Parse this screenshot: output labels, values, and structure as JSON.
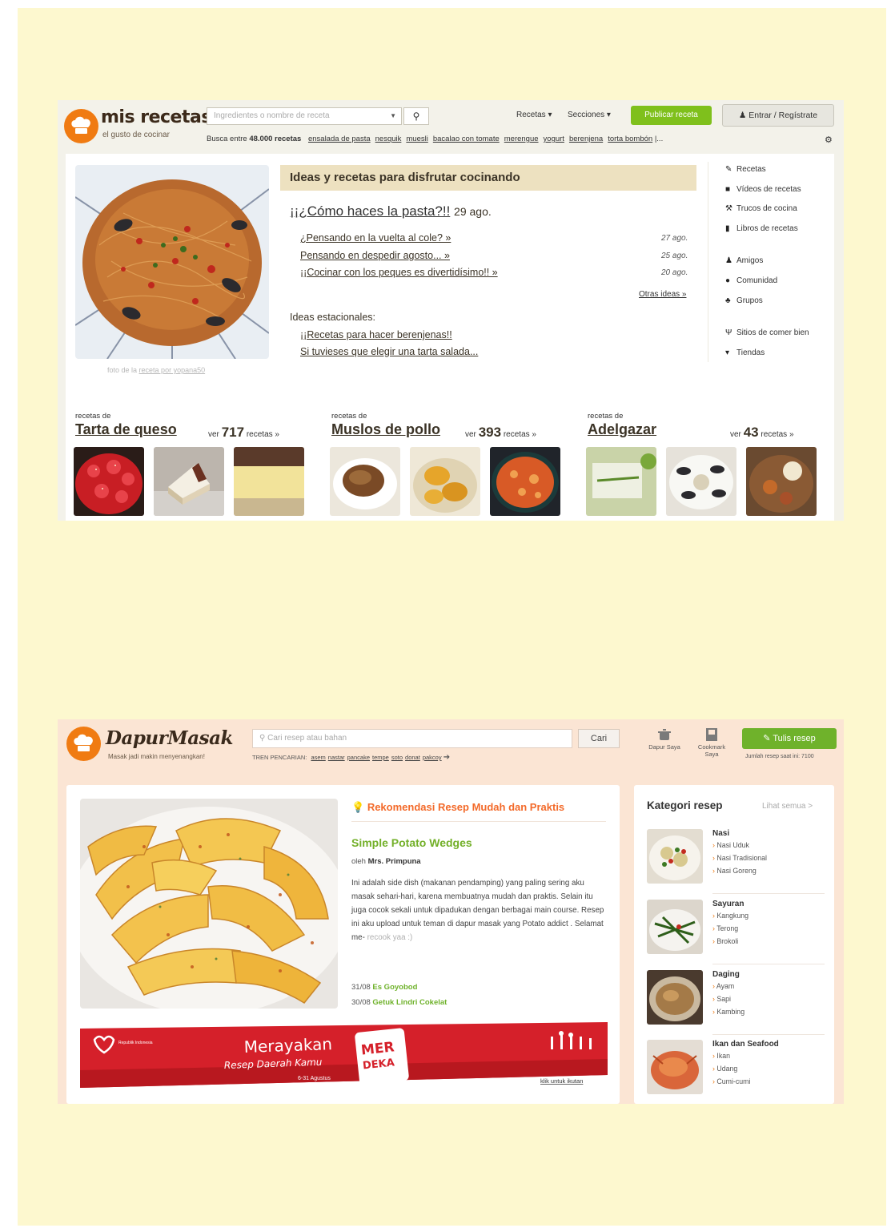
{
  "mis_recetas": {
    "brand": "mis recetas",
    "tagline": "el gusto de cocinar",
    "search_placeholder": "Ingredientes o nombre de receta",
    "busca_prefix": "Busca entre",
    "busca_count": "48.000 recetas",
    "busca_links": [
      "ensalada de pasta",
      "nesquik",
      "muesli",
      "bacalao con tomate",
      "merengue",
      "yogurt",
      "berenjena",
      "torta bombón"
    ],
    "more": "|...",
    "nav": [
      "Recetas ▾",
      "Secciones ▾"
    ],
    "publish": "Publicar receta",
    "login": "Entrar / Regístrate",
    "ideas_title": "Ideas y recetas para disfrutar cocinando",
    "main_idea": "¡¡¿Cómo haces la pasta?!!",
    "main_date": "29 ago.",
    "sub_ideas": [
      {
        "text": "¿Pensando en la vuelta al cole? »",
        "date": "27 ago."
      },
      {
        "text": "Pensando en despedir agosto... »",
        "date": "25 ago."
      },
      {
        "text": "¡¡Cocinar con los peques es divertidísimo!! »",
        "date": "20 ago."
      }
    ],
    "otras": "Otras ideas »",
    "estacionales_label": "Ideas estacionales:",
    "estacionales": [
      "¡¡Recetas para hacer berenjenas!!",
      "Si tuvieses que elegir una tarta salada..."
    ],
    "photo_credit_prefix": "foto de la",
    "photo_credit_link": "receta por yopana50",
    "side_links": [
      "Recetas",
      "Vídeos de recetas",
      "Trucos de cocina",
      "Libros de recetas",
      "Amigos",
      "Comunidad",
      "Grupos",
      "Sitios de comer bien",
      "Tiendas"
    ],
    "side_icons": [
      "pencil-icon",
      "video-icon",
      "tools-icon",
      "book-icon",
      "user-icon",
      "chat-icon",
      "group-icon",
      "cutlery-icon",
      "cart-icon"
    ],
    "categories": [
      {
        "pre": "recetas de",
        "name": "Tarta de queso",
        "ver": "ver",
        "count": "717",
        "suffix": "recetas »"
      },
      {
        "pre": "recetas de",
        "name": "Muslos de pollo",
        "ver": "ver",
        "count": "393",
        "suffix": "recetas »"
      },
      {
        "pre": "recetas de",
        "name": "Adelgazar",
        "ver": "ver",
        "count": "43",
        "suffix": "recetas »"
      }
    ]
  },
  "dapur": {
    "brand": "DapurMasak",
    "tagline": "Masak jadi makin menyenangkan!",
    "search_placeholder": "Cari resep atau bahan",
    "search_button": "Cari",
    "tren_label": "TREN PENCARIAN:",
    "tren_links": [
      "asem",
      "nastar",
      "pancake",
      "tempe",
      "soto",
      "donat",
      "pakcoy"
    ],
    "dapur_saya": "Dapur Saya",
    "cookmark_saya": "Cookmark Saya",
    "tulis_resep": "Tulis resep",
    "jumlah": "Jumlah resep saat ini: 7100",
    "rek_title": "Rekomendasi Resep Mudah dan Praktis",
    "recipe_title": "Simple Potato Wedges",
    "oleh": "oleh",
    "author": "Mrs. Primpuna",
    "desc_main": "Ini adalah side dish (makanan pendamping) yang paling sering aku masak sehari-hari, karena membuatnya mudah dan praktis. Selain itu juga cocok sekali untuk dipadukan dengan berbagai main course. Resep ini aku upload untuk teman di dapur masak yang Potato addict . Selamat me-",
    "desc_fade": "recook yaa :)",
    "related": [
      {
        "date": "31/08",
        "title": "Es Goyobod"
      },
      {
        "date": "30/08",
        "title": "Getuk Lindri Cokelat"
      }
    ],
    "banner_main": "Merayakan",
    "banner_sub": "Resep Daerah Kamu",
    "banner_date": "6-31 Agustus",
    "banner_badge_1": "MER",
    "banner_badge_2": "DEKA",
    "banner_link": "klik untuk ikutan",
    "banner_logo": "Republik Indonesia",
    "kategori_title": "Kategori resep",
    "lihat_semua": "Lihat semua >",
    "categories": [
      {
        "name": "Nasi",
        "items": [
          "Nasi Uduk",
          "Nasi Tradisional",
          "Nasi Goreng"
        ]
      },
      {
        "name": "Sayuran",
        "items": [
          "Kangkung",
          "Terong",
          "Brokoli"
        ]
      },
      {
        "name": "Daging",
        "items": [
          "Ayam",
          "Sapi",
          "Kambing"
        ]
      },
      {
        "name": "Ikan dan Seafood",
        "items": [
          "Ikan",
          "Udang",
          "Cumi-cumi"
        ]
      }
    ]
  }
}
